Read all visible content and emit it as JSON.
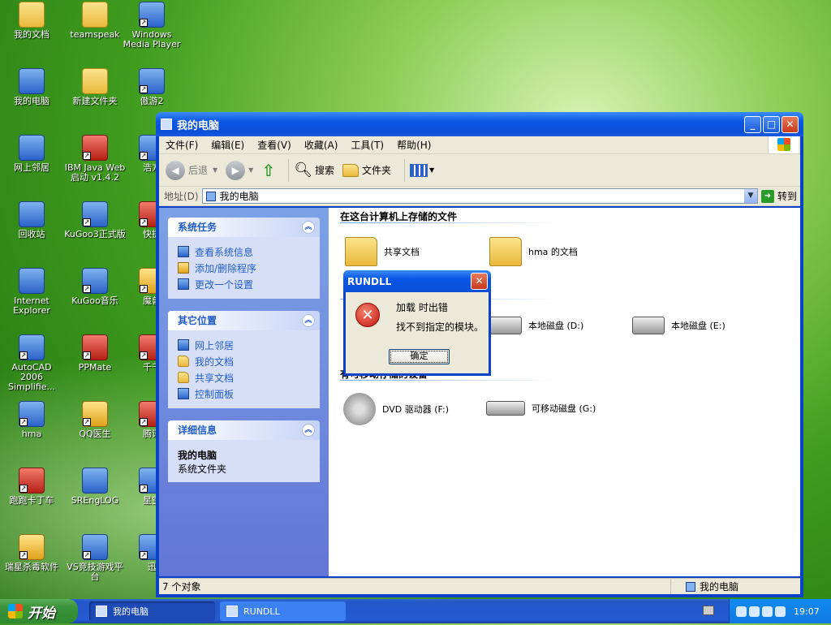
{
  "desktop": {
    "icons": [
      {
        "label": "我的文档",
        "kind": "folder",
        "shortcut": false
      },
      {
        "label": "teamspeak",
        "kind": "folder",
        "shortcut": false
      },
      {
        "label": "Windows\nMedia Player",
        "kind": "generic",
        "shortcut": true
      },
      {
        "label": "我的电脑",
        "kind": "generic",
        "shortcut": false
      },
      {
        "label": "新建文件夹",
        "kind": "folder",
        "shortcut": false
      },
      {
        "label": "傲游2",
        "kind": "generic",
        "shortcut": true
      },
      {
        "label": "网上邻居",
        "kind": "generic",
        "shortcut": false
      },
      {
        "label": "IBM Java Web\n启动 v1.4.2",
        "kind": "red",
        "shortcut": true
      },
      {
        "label": "浩方",
        "kind": "generic",
        "shortcut": true
      },
      {
        "label": "回收站",
        "kind": "generic",
        "shortcut": false
      },
      {
        "label": "KuGoo3正式版",
        "kind": "generic",
        "shortcut": true
      },
      {
        "label": "快捷",
        "kind": "red",
        "shortcut": true
      },
      {
        "label": "Internet\nExplorer",
        "kind": "generic",
        "shortcut": false
      },
      {
        "label": "KuGoo音乐",
        "kind": "generic",
        "shortcut": true
      },
      {
        "label": "魔兽",
        "kind": "yellow",
        "shortcut": true
      },
      {
        "label": "AutoCAD 2006\nSimplifie...",
        "kind": "generic",
        "shortcut": true
      },
      {
        "label": "PPMate",
        "kind": "red",
        "shortcut": true
      },
      {
        "label": "千千",
        "kind": "red",
        "shortcut": true
      },
      {
        "label": "hma",
        "kind": "generic",
        "shortcut": true
      },
      {
        "label": "QQ医生",
        "kind": "yellow",
        "shortcut": true
      },
      {
        "label": "腾讯",
        "kind": "red",
        "shortcut": true
      },
      {
        "label": "跑跑卡丁车",
        "kind": "red",
        "shortcut": true
      },
      {
        "label": "SREngLOG",
        "kind": "generic",
        "shortcut": false
      },
      {
        "label": "星空",
        "kind": "generic",
        "shortcut": true
      },
      {
        "label": "瑞星杀毒软件",
        "kind": "yellow",
        "shortcut": true
      },
      {
        "label": "VS竞技游戏平\n台",
        "kind": "generic",
        "shortcut": true
      },
      {
        "label": "迅",
        "kind": "generic",
        "shortcut": true
      }
    ]
  },
  "window": {
    "title": "我的电脑",
    "menu": [
      "文件(F)",
      "编辑(E)",
      "查看(V)",
      "收藏(A)",
      "工具(T)",
      "帮助(H)"
    ],
    "toolbar": {
      "back": "后退",
      "search": "搜索",
      "folders": "文件夹"
    },
    "address": {
      "label": "地址(D)",
      "value": "我的电脑",
      "go": "转到"
    },
    "left": {
      "system_tasks": {
        "title": "系统任务",
        "items": [
          "查看系统信息",
          "添加/删除程序",
          "更改一个设置"
        ]
      },
      "other_places": {
        "title": "其它位置",
        "items": [
          "网上邻居",
          "我的文档",
          "共享文档",
          "控制面板"
        ]
      },
      "details": {
        "title": "详细信息",
        "name": "我的电脑",
        "type": "系统文件夹"
      }
    },
    "right": {
      "group1": "在这台计算机上存储的文件",
      "group2": "有可移动存储的设备",
      "items": {
        "shared": "共享文档",
        "hma_docs": "hma 的文档",
        "disk_d": "本地磁盘 (D:)",
        "disk_e": "本地磁盘 (E:)",
        "dvd": "DVD 驱动器 (F:)",
        "removable": "可移动磁盘 (G:)"
      }
    },
    "status": {
      "count": "7 个对象",
      "location": "我的电脑"
    }
  },
  "dialog": {
    "title": "RUNDLL",
    "line1": "加载  时出错",
    "line2": "找不到指定的模块。",
    "ok": "确定"
  },
  "taskbar": {
    "start": "开始",
    "tasks": [
      "我的电脑",
      "RUNDLL"
    ],
    "clock": "19:07"
  }
}
